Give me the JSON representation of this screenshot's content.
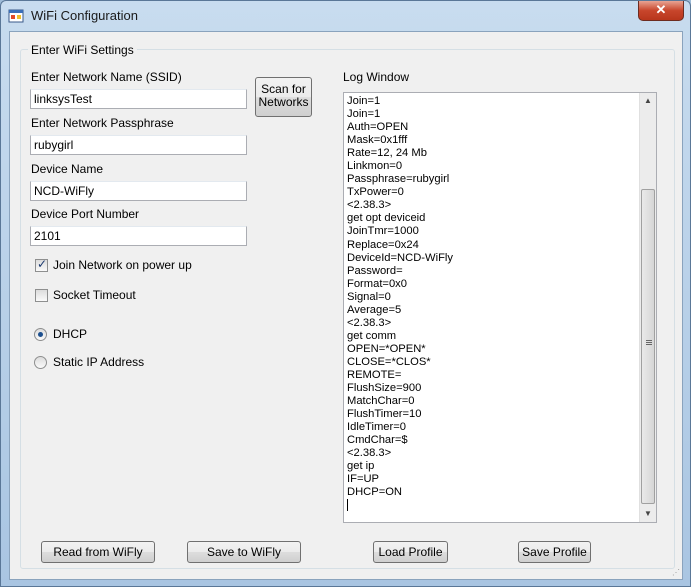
{
  "window": {
    "title": "WiFi Configuration",
    "close_glyph": "✕"
  },
  "group": {
    "label": "Enter WiFi Settings"
  },
  "form": {
    "ssid_label": "Enter Network Name (SSID)",
    "ssid_value": "linksysTest",
    "pass_label": "Enter Network Passphrase",
    "pass_value": "rubygirl",
    "device_name_label": "Device Name",
    "device_name_value": "NCD-WiFly",
    "port_label": "Device Port Number",
    "port_value": "2101",
    "join_label": "Join Network on power up",
    "join_checked": true,
    "socket_label": "Socket Timeout",
    "socket_checked": false,
    "dhcp_label": "DHCP",
    "dhcp_selected": true,
    "static_label": "Static IP Address",
    "static_selected": false
  },
  "scan_button": {
    "line1": "Scan for",
    "line2": "Networks"
  },
  "log": {
    "label": "Log Window",
    "lines": [
      "Join=1",
      "Join=1",
      "Auth=OPEN",
      "Mask=0x1fff",
      "Rate=12, 24 Mb",
      "Linkmon=0",
      "Passphrase=rubygirl",
      "TxPower=0",
      "<2.38.3>",
      "get opt deviceid",
      "JoinTmr=1000",
      "Replace=0x24",
      "DeviceId=NCD-WiFly",
      "Password=",
      "Format=0x0",
      "Signal=0",
      "Average=5",
      "<2.38.3>",
      "get comm",
      "OPEN=*OPEN*",
      "CLOSE=*CLOS*",
      "REMOTE=",
      "FlushSize=900",
      "MatchChar=0",
      "FlushTimer=10",
      "IdleTimer=0",
      "CmdChar=$",
      "<2.38.3>",
      "get ip",
      "IF=UP",
      "DHCP=ON"
    ]
  },
  "buttons": {
    "read": "Read from WiFly",
    "save": "Save to WiFly",
    "load_profile": "Load Profile",
    "save_profile": "Save Profile"
  },
  "icons": {
    "app": "app-window-icon",
    "check": "✓",
    "scroll_up": "▲",
    "scroll_down": "▼"
  },
  "colors": {
    "title_bar": "#b9d1ea",
    "close_button": "#c8462c",
    "client_bg": "#f0f0f0"
  }
}
